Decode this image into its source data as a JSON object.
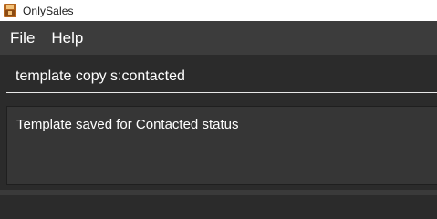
{
  "window": {
    "title": "OnlySales",
    "icon": "app-logo-icon"
  },
  "menubar": {
    "items": [
      {
        "label": "File"
      },
      {
        "label": "Help"
      }
    ]
  },
  "command_box": {
    "value": "template copy s:contacted"
  },
  "result_display": {
    "text": "Template saved for Contacted status"
  },
  "colors": {
    "background": "#2b2b2b",
    "menubar": "#3c3c3c",
    "result_box": "#363636",
    "text": "#ffffff"
  }
}
